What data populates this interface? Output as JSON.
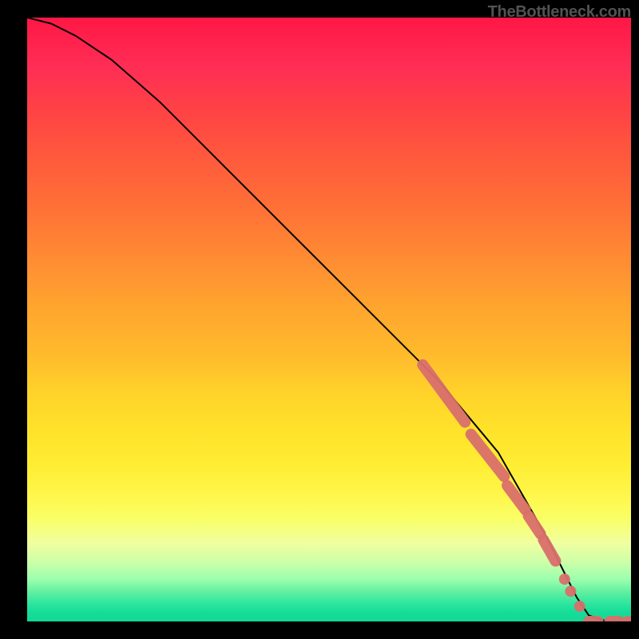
{
  "watermark": "TheBottleneck.com",
  "chart_data": {
    "type": "line",
    "title": "",
    "xlabel": "",
    "ylabel": "",
    "xlim": [
      0,
      100
    ],
    "ylim": [
      0,
      100
    ],
    "grid": false,
    "legend": false,
    "series": [
      {
        "name": "curve",
        "x": [
          0,
          4,
          8,
          14,
          22,
          32,
          44,
          56,
          68,
          78,
          86,
          89,
          91,
          93,
          96,
          100
        ],
        "y": [
          100,
          99,
          97,
          93,
          86,
          76,
          64,
          52,
          40,
          28,
          14,
          8,
          4,
          1,
          0,
          0
        ]
      }
    ],
    "overlay_segments": [
      {
        "x0": 65.5,
        "y0": 42.5,
        "x1": 72.5,
        "y1": 33.0
      },
      {
        "x0": 73.5,
        "y0": 31.0,
        "x1": 79.0,
        "y1": 24.0
      },
      {
        "x0": 79.5,
        "y0": 22.5,
        "x1": 82.5,
        "y1": 18.5
      },
      {
        "x0": 83.0,
        "y0": 17.5,
        "x1": 85.0,
        "y1": 14.5
      },
      {
        "x0": 85.5,
        "y0": 13.5,
        "x1": 87.5,
        "y1": 10.0
      }
    ],
    "overlay_points": [
      {
        "x": 89.0,
        "y": 7.0
      },
      {
        "x": 90.0,
        "y": 5.0
      },
      {
        "x": 91.5,
        "y": 2.5
      }
    ],
    "tail_segments": [
      {
        "x0": 93.0,
        "y0": 0.0,
        "x1": 94.5,
        "y1": 0.0
      },
      {
        "x0": 96.5,
        "y0": 0.0,
        "x1": 98.0,
        "y1": 0.0
      }
    ],
    "tail_points": [
      {
        "x": 99.5,
        "y": 0.0
      }
    ]
  }
}
